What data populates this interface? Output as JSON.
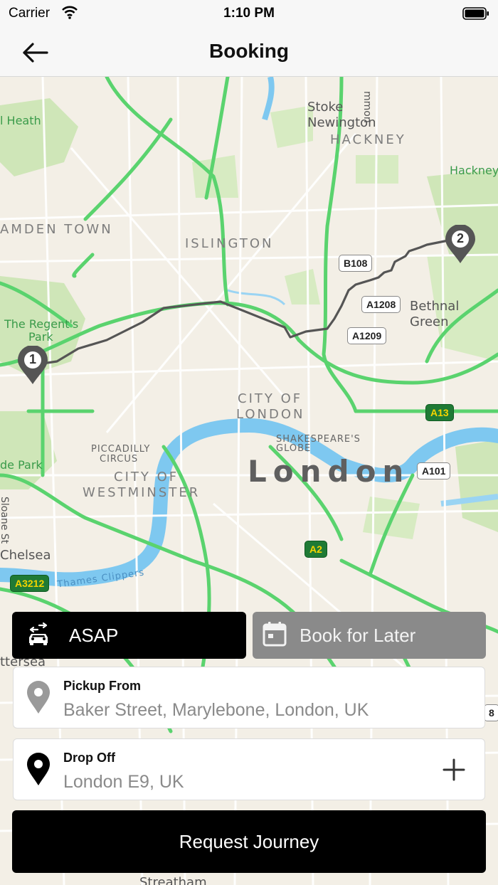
{
  "status_bar": {
    "carrier": "Carrier",
    "time": "1:10 PM"
  },
  "nav": {
    "title": "Booking"
  },
  "map": {
    "districts": {
      "camden": "AMDEN TOWN",
      "islington": "ISLINGTON",
      "hackney": "HACKNEY",
      "city1": "CITY OF",
      "city2": "LONDON",
      "westminster1": "CITY OF",
      "westminster2": "WESTMINSTER"
    },
    "places": {
      "stoke1": "Stoke",
      "stoke2": "Newington",
      "bethnal1": "Bethnal",
      "bethnal2": "Green",
      "chelsea": "Chelsea",
      "sloane": "Sloane St",
      "battersea": "ttersea",
      "streatham": "Streatham",
      "london": "London",
      "hackney_side": "Hackney",
      "mmon": "mmon"
    },
    "parks": {
      "heath": "l Heath",
      "regents1": "The Regent's",
      "regents2": "Park",
      "hyde": "de Park",
      "thames": "Thames Clippers"
    },
    "landmarks": {
      "piccadilly1": "PICCADILLY",
      "piccadilly2": "CIRCUS",
      "globe1": "SHAKESPEARE'S",
      "globe2": "GLOBE"
    },
    "roads": {
      "b108": "B108",
      "a1208": "A1208",
      "a1209": "A1209",
      "a13": "A13",
      "a101": "A101",
      "a2": "A2",
      "a3212": "A3212",
      "edge8": "8"
    },
    "pins": {
      "start": "1",
      "end": "2"
    }
  },
  "booking": {
    "asap_label": "ASAP",
    "later_label": "Book for Later",
    "pickup_title": "Pickup From",
    "pickup_value": "Baker Street, Marylebone, London, UK",
    "dropoff_title": "Drop Off",
    "dropoff_value": "London E9, UK",
    "request_label": "Request Journey"
  },
  "colors": {
    "accent": "#000000",
    "secondary_button": "#8a8a8a",
    "route": "#555555",
    "roads_green": "#5ad36e"
  },
  "icons": {
    "back": "back-arrow-icon",
    "car": "car-swap-icon",
    "calendar": "calendar-icon",
    "pickup": "pickup-pin-icon",
    "dropoff": "dropoff-pin-icon",
    "add": "plus-icon"
  }
}
